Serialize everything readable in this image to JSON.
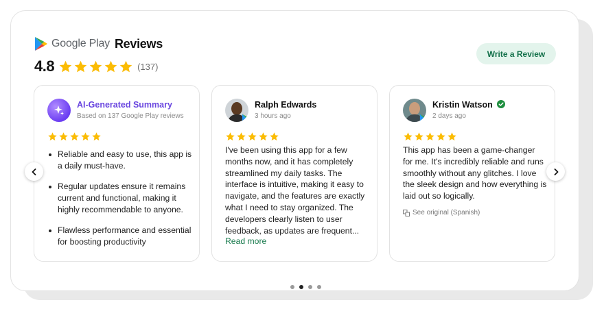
{
  "header": {
    "brand_name": "Google Play",
    "title": "Reviews",
    "rating": "4.8",
    "rating_stars": 5,
    "review_count": "(137)"
  },
  "actions": {
    "write_review_label": "Write a Review"
  },
  "summary_card": {
    "icon": "sparkle-icon",
    "title": "AI-Generated Summary",
    "subtitle": "Based on 137 Google Play reviews",
    "stars": 5,
    "bullets": [
      "Reliable and easy to use, this app is a daily must-have.",
      "Regular updates ensure it remains current and functional, making it highly recommendable to anyone.",
      "Flawless performance and essential for boosting productivity"
    ]
  },
  "reviews": [
    {
      "author": "Ralph Edwards",
      "time": "3 hours ago",
      "stars": 5,
      "text": "I've been using this app for a few months now, and it has completely streamlined my daily tasks. The interface is intuitive, making it easy to navigate, and the features are exactly what I need to stay organized. The developers clearly listen to user feedback, as updates are frequent...",
      "read_more_label": "Read more"
    },
    {
      "author": "Kristin Watson",
      "verified": true,
      "time": "2 days ago",
      "stars": 5,
      "text": "This app has been a game-changer for me. It's incredibly reliable and runs smoothly without any glitches. I love the sleek design and how everything is laid out so logically.",
      "see_original_label": "See original (Spanish)"
    }
  ],
  "carousel": {
    "prev_icon": "chevron-left-icon",
    "next_icon": "chevron-right-icon",
    "page_count": 4,
    "active_page": 2
  },
  "colors": {
    "star": "#fbbc04",
    "accent_green": "#16794b",
    "button_bg": "#e3f4ec",
    "ai_purple": "#6b48e0"
  }
}
